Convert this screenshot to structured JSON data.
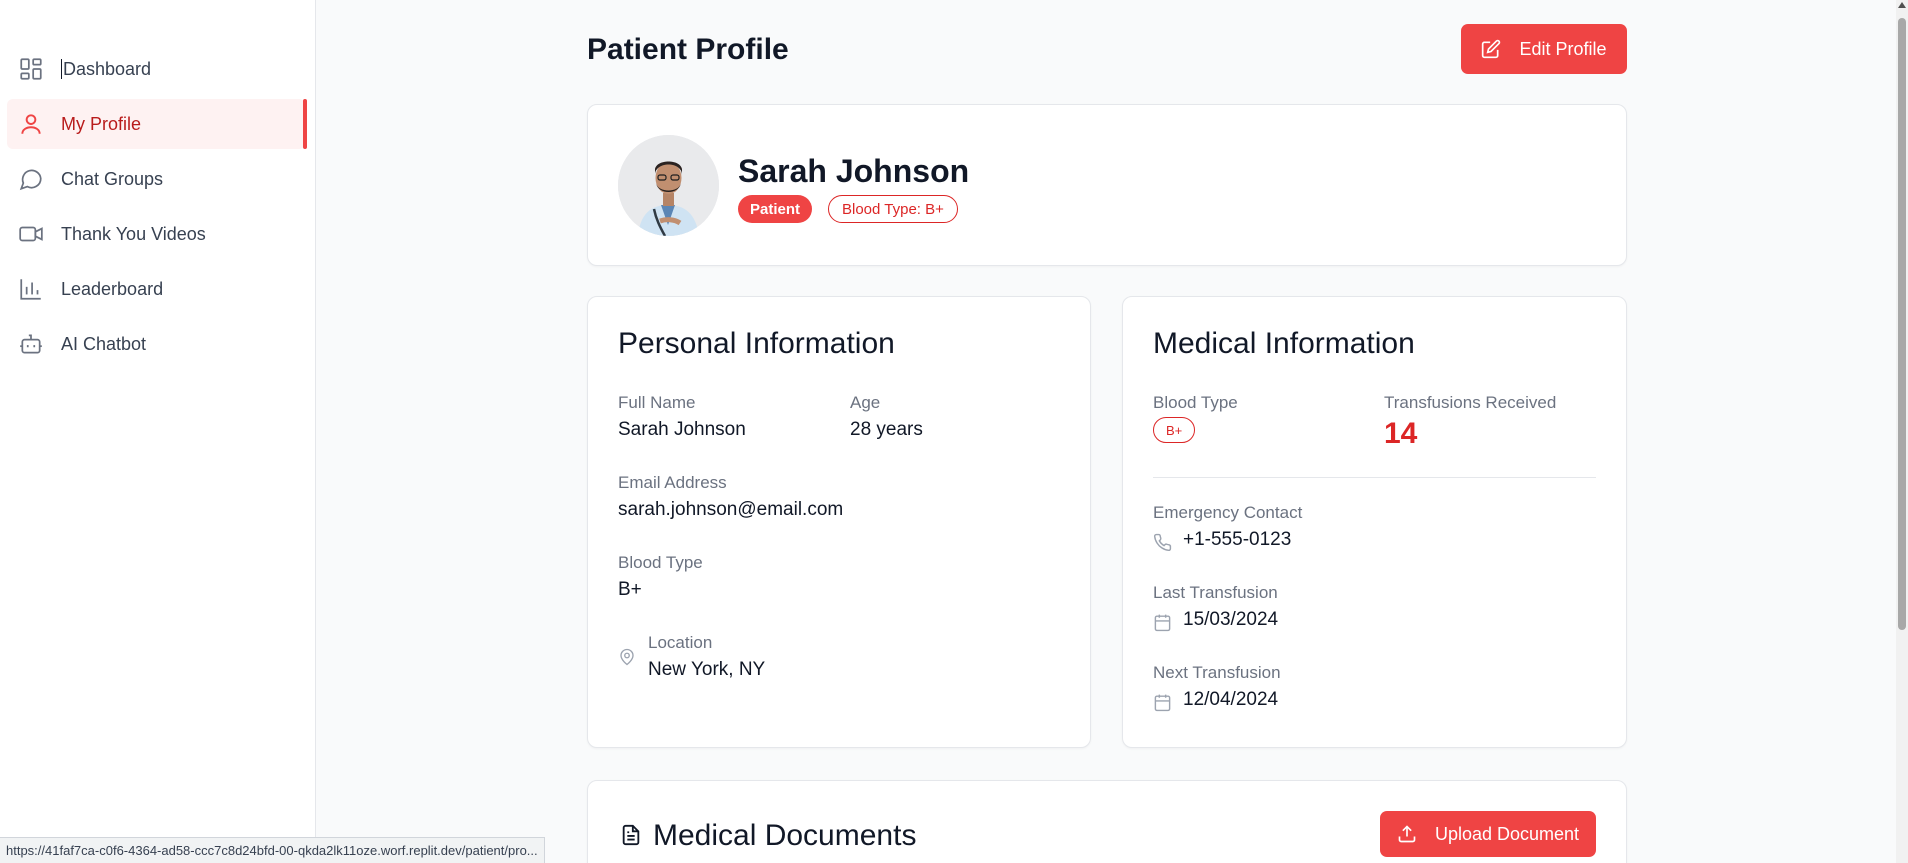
{
  "sidebar": {
    "items": [
      {
        "label": "Dashboard",
        "icon": "layout-grid-icon"
      },
      {
        "label": "My Profile",
        "icon": "user-icon"
      },
      {
        "label": "Chat Groups",
        "icon": "message-circle-icon"
      },
      {
        "label": "Thank You Videos",
        "icon": "video-icon"
      },
      {
        "label": "Leaderboard",
        "icon": "bar-chart-icon"
      },
      {
        "label": "AI Chatbot",
        "icon": "bot-icon"
      }
    ]
  },
  "header": {
    "title": "Patient Profile",
    "edit_label": "Edit Profile"
  },
  "profile": {
    "name": "Sarah Johnson",
    "role_badge": "Patient",
    "blood_badge": "Blood Type: B+"
  },
  "personal": {
    "title": "Personal Information",
    "full_name_label": "Full Name",
    "full_name": "Sarah Johnson",
    "age_label": "Age",
    "age": "28 years",
    "email_label": "Email Address",
    "email": "sarah.johnson@email.com",
    "blood_type_label": "Blood Type",
    "blood_type": "B+",
    "location_label": "Location",
    "location": "New York, NY"
  },
  "medical": {
    "title": "Medical Information",
    "blood_type_label": "Blood Type",
    "blood_type": "B+",
    "transfusions_label": "Transfusions Received",
    "transfusions": "14",
    "emergency_label": "Emergency Contact",
    "emergency": "+1-555-0123",
    "last_label": "Last Transfusion",
    "last": "15/03/2024",
    "next_label": "Next Transfusion",
    "next": "12/04/2024"
  },
  "documents": {
    "title": "Medical Documents",
    "upload_label": "Upload Document"
  },
  "status_bar": {
    "url": "https://41faf7ca-c0f6-4364-ad58-ccc7c8d24bfd-00-qkda2lk11oze.worf.replit.dev/patient/pro..."
  },
  "colors": {
    "accent": "#ef4444",
    "accent_dark": "#dc2626",
    "active_bg": "#fef2f2"
  }
}
